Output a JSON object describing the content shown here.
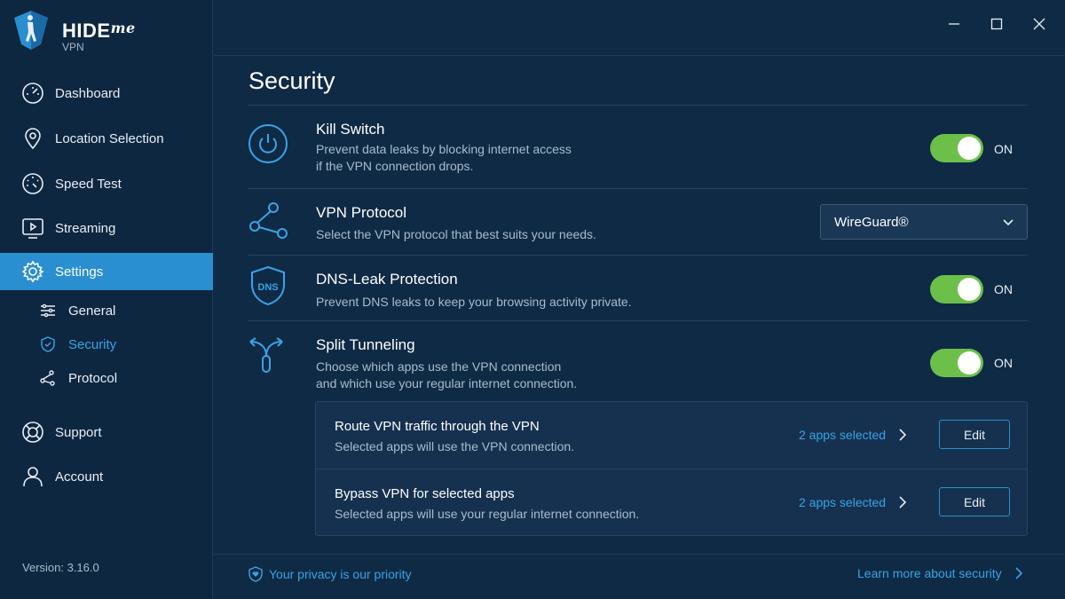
{
  "app": {
    "brand": "HIDE",
    "brand_suffix": "me",
    "brand_sub": "VPN",
    "version": "Version: 3.16.0"
  },
  "nav": {
    "dashboard": "Dashboard",
    "location": "Location Selection",
    "speed": "Speed Test",
    "streaming": "Streaming",
    "settings": "Settings",
    "support": "Support",
    "account": "Account"
  },
  "settings_sub": {
    "general": "General",
    "security": "Security",
    "protocol": "Protocol"
  },
  "page": {
    "title": "Security"
  },
  "kill_switch": {
    "title": "Kill Switch",
    "desc1": "Prevent data leaks by blocking internet access",
    "desc2": "if the VPN connection drops.",
    "state": "ON"
  },
  "vpn_protocol": {
    "title": "VPN Protocol",
    "desc": "Select the VPN protocol that best suits your needs.",
    "selected": "WireGuard®"
  },
  "dns": {
    "icon_text": "DNS",
    "title": "DNS-Leak Protection",
    "desc": "Prevent DNS leaks to keep your browsing activity private.",
    "state": "ON"
  },
  "split": {
    "title": "Split Tunneling",
    "desc1": "Choose which apps use the VPN connection",
    "desc2": "and which use your regular internet connection.",
    "state": "ON",
    "route": {
      "title": "Route VPN traffic through the VPN",
      "desc": "Selected apps will use the VPN connection.",
      "link": "2 apps selected",
      "button": "Edit"
    },
    "bypass": {
      "title": "Bypass VPN for selected apps",
      "desc": "Selected apps will use your regular internet connection.",
      "link": "2 apps selected",
      "button": "Edit"
    }
  },
  "footer": {
    "left": "Your privacy is our priority",
    "right": "Learn more about security"
  },
  "colors": {
    "accent": "#2a8fd0",
    "link": "#3aa3e6",
    "toggle_on": "#6cc04a",
    "bg": "#0f2a45"
  }
}
